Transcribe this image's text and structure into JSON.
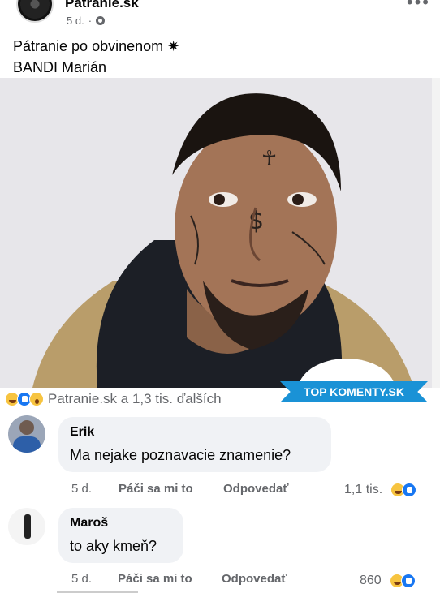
{
  "post": {
    "page_name": "Patranie.sk",
    "age": "5 d.",
    "separator": "·",
    "privacy_icon": "gear-icon",
    "more_icon": "more-dots-icon",
    "text_line1": "Pátranie po obvinenom ✷",
    "text_line2": "BANDI Marián"
  },
  "reactions": {
    "icons": [
      "haha-icon",
      "like-icon",
      "wow-icon"
    ],
    "summary": "Patranie.sk a 1,3 tis. ďalších"
  },
  "badge": {
    "label": "TOP KOMENTY.SK"
  },
  "comments": [
    {
      "author": "Erik",
      "text": "Ma nejake poznavacie znamenie?",
      "age": "5 d.",
      "like_label": "Páči sa mi to",
      "reply_label": "Odpovedať",
      "reaction_count": "1,1 tis."
    },
    {
      "author": "Maroš",
      "text": "to aky kmeň?",
      "age": "5 d.",
      "like_label": "Páči sa mi to",
      "reply_label": "Odpovedať",
      "reaction_count": "860"
    }
  ],
  "colors": {
    "accent": "#1877f2",
    "badge": "#1a92d6",
    "muted": "#65676b",
    "bubble": "#f0f2f5"
  }
}
